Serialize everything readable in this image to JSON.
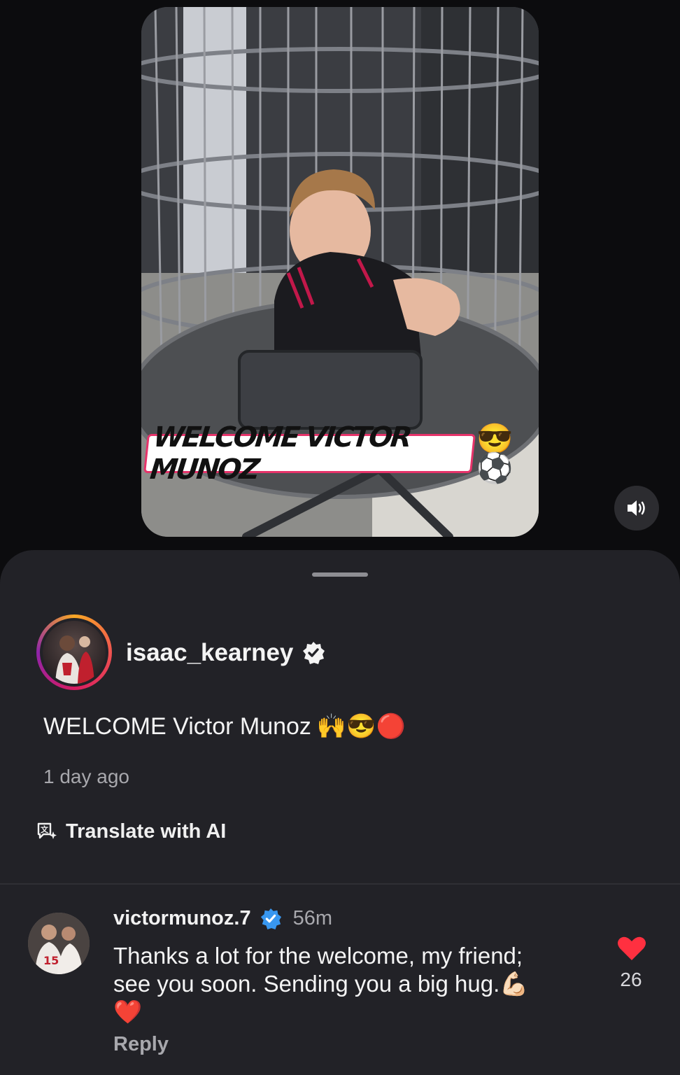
{
  "video": {
    "overlay_text": "WELCOME VICTOR MUNOZ",
    "overlay_emojis": "😎⚽",
    "sound_icon": "speaker-icon"
  },
  "post": {
    "username": "isaac_kearney",
    "verified_icon": "verified-badge-icon",
    "caption": "WELCOME Victor Munoz",
    "caption_emojis": "🙌😎🔴",
    "time": "1 day ago",
    "translate_label": "Translate with AI",
    "translate_icon": "translate-ai-icon"
  },
  "comment": {
    "username": "victormunoz.7",
    "verified_icon": "verified-badge-icon",
    "time": "56m",
    "line1": "Thanks a lot for the welcome, my friend;",
    "line2": "see you soon. Sending you a big hug.💪🏻",
    "line3": "❤️",
    "reply_label": "Reply",
    "like_icon": "heart-icon",
    "like_count": "26"
  },
  "colors": {
    "background": "#0c0c0e",
    "sheet": "#222227",
    "verified_blue": "#3897f0",
    "like_red": "#ff3040"
  }
}
